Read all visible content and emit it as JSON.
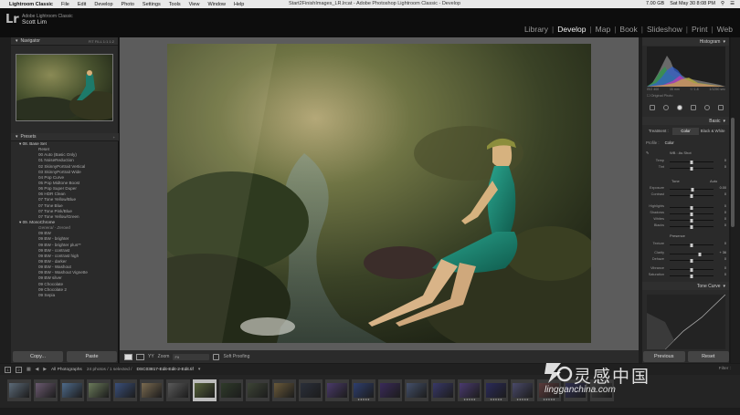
{
  "menubar": {
    "apple": "",
    "items": [
      "Lightroom Classic",
      "File",
      "Edit",
      "Develop",
      "Photo",
      "Settings",
      "Tools",
      "View",
      "Window",
      "Help"
    ],
    "window_title": "Start2FinishImages_LR.lrcat - Adobe Photoshop Lightroom Classic - Develop",
    "status": {
      "storage": "7.00 GB",
      "clock": "Sat May 30 8:08 PM"
    }
  },
  "identity": {
    "logo": "Lr",
    "product": "Adobe Lightroom Classic",
    "user": "Scott Lim"
  },
  "modules": [
    "Library",
    "Develop",
    "Map",
    "Book",
    "Slideshow",
    "Print",
    "Web"
  ],
  "active_module": "Develop",
  "left": {
    "navigator": {
      "title": "Navigator",
      "opts": "FIT   FILL   1:1   1:2"
    },
    "presets": {
      "title": "Presets",
      "rows": [
        {
          "type": "folder",
          "label": "▾ 08. Base Set"
        },
        {
          "type": "item",
          "label": "Reset"
        },
        {
          "type": "item",
          "label": "00 Auto (Basic Only)"
        },
        {
          "type": "item",
          "label": "01 NoiseReduction"
        },
        {
          "type": "item",
          "label": "02 SkinnyPortrait Vertical"
        },
        {
          "type": "item",
          "label": "03 SkinnyPortrait Wide"
        },
        {
          "type": "item",
          "label": "04 Pop Curve"
        },
        {
          "type": "item",
          "label": "05 Pop Midtone Boost"
        },
        {
          "type": "item",
          "label": "06 Pop Super Duper"
        },
        {
          "type": "item",
          "label": "06 HDR Clean"
        },
        {
          "type": "item",
          "label": "07 Tone Yellow/Blue"
        },
        {
          "type": "item",
          "label": "07 Tone Blue"
        },
        {
          "type": "item",
          "label": "07 Tone Pink/Blue"
        },
        {
          "type": "item",
          "label": "07 Tone Yellow/Green"
        },
        {
          "type": "folder",
          "label": "▾ 09. MonoChrome"
        },
        {
          "type": "item",
          "label": "General - Zeroed",
          "italic": true
        },
        {
          "type": "item",
          "label": "09 BW"
        },
        {
          "type": "item",
          "label": "09 BW - brighter"
        },
        {
          "type": "item",
          "label": "09 BW - brighter plus**"
        },
        {
          "type": "item",
          "label": "09 BW - contrast"
        },
        {
          "type": "item",
          "label": "09 BW - contrast high"
        },
        {
          "type": "item",
          "label": "09 BW - darker"
        },
        {
          "type": "item",
          "label": "09 BW - Washout"
        },
        {
          "type": "item",
          "label": "09 BW - Washout Vignette"
        },
        {
          "type": "item",
          "label": "09 BW silver"
        },
        {
          "type": "item",
          "label": "09 Chocolate"
        },
        {
          "type": "item",
          "label": "09 Chocolate 2"
        },
        {
          "type": "item",
          "label": "09 Sepia"
        }
      ]
    },
    "copy_label": "Copy...",
    "paste_label": "Paste"
  },
  "toolbar": {
    "zoom_label": "Zoom",
    "zoom_value": "Fit",
    "soft_proofing": "Soft Proofing"
  },
  "right": {
    "histogram_title": "Histogram",
    "hist_labels": [
      "ISO 400",
      "35 mm",
      "f / 1.8",
      "1/1250 sec"
    ],
    "original_photo": "Original Photo",
    "basic_title": "Basic",
    "treatment": [
      "Treatment :",
      "Color",
      "Black & White"
    ],
    "profile_label": "Profile :",
    "profile_value": "Color",
    "wb_label": "WB :",
    "wb_value": "As Shot",
    "tone_label": "Tone",
    "tone_auto": "Auto",
    "presence_label": "Presence",
    "sliders": [
      {
        "name": "Temp",
        "pos": 0.5,
        "value": "0"
      },
      {
        "name": "Tint",
        "pos": 0.5,
        "value": "0"
      },
      {
        "name": "Exposure",
        "pos": 0.52,
        "value": "0.00"
      },
      {
        "name": "Contrast",
        "pos": 0.5,
        "value": "0"
      },
      {
        "name": "Highlights",
        "pos": 0.5,
        "value": "0"
      },
      {
        "name": "Shadows",
        "pos": 0.5,
        "value": "0"
      },
      {
        "name": "Whites",
        "pos": 0.5,
        "value": "0"
      },
      {
        "name": "Blacks",
        "pos": 0.5,
        "value": "0"
      },
      {
        "name": "Texture",
        "pos": 0.5,
        "value": "0"
      },
      {
        "name": "Clarity",
        "pos": 0.68,
        "value": "+ 36"
      },
      {
        "name": "Dehaze",
        "pos": 0.5,
        "value": "0"
      },
      {
        "name": "Vibrance",
        "pos": 0.5,
        "value": "0"
      },
      {
        "name": "Saturation",
        "pos": 0.5,
        "value": "0"
      }
    ],
    "tonecurve_title": "Tone Curve",
    "previous_label": "Previous",
    "reset_label": "Reset"
  },
  "filmstrip": {
    "monitor_1": "1",
    "monitor_2": "2",
    "source": "All Photographs",
    "count": "24 photos / 1 selected /",
    "filename": "DSC03817-Edit-Edit-2-Edit.tif",
    "filter": "Filter :",
    "thumb_count": 23,
    "selected_index": 7,
    "rated": [
      13,
      17,
      18,
      19,
      20
    ]
  },
  "watermark": {
    "cn": "灵感中国",
    "en": "lingganchina.com"
  }
}
